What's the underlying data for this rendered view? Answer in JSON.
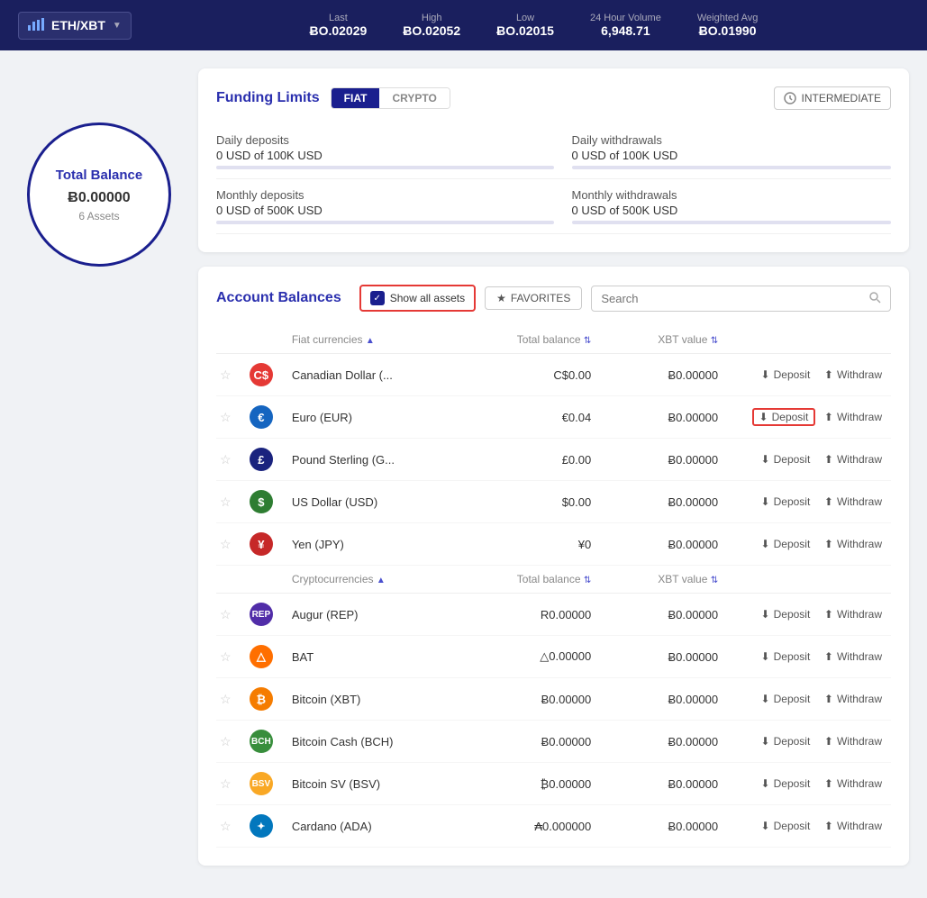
{
  "header": {
    "pair": "ETH/XBT",
    "chart_icon": "chart-icon",
    "stats": [
      {
        "label": "Last",
        "value": "ɃO.02029"
      },
      {
        "label": "High",
        "value": "ɃO.02052"
      },
      {
        "label": "Low",
        "value": "ɃO.02015"
      },
      {
        "label": "24 Hour Volume",
        "value": "6,948.71"
      },
      {
        "label": "Weighted Avg",
        "value": "ɃO.01990"
      }
    ]
  },
  "total_balance": {
    "title": "Total Balance",
    "amount": "Ƀ0.00000",
    "assets": "6 Assets"
  },
  "funding_limits": {
    "title": "Funding Limits",
    "fiat_label": "FIAT",
    "crypto_label": "CRYPTO",
    "intermediate_label": "INTERMEDIATE",
    "rows": [
      {
        "label": "Daily deposits",
        "value": "0 USD of 100K USD",
        "side": "left"
      },
      {
        "label": "Daily withdrawals",
        "value": "0 USD of 100K USD",
        "side": "right"
      },
      {
        "label": "Monthly deposits",
        "value": "0 USD of 500K USD",
        "side": "left"
      },
      {
        "label": "Monthly withdrawals",
        "value": "0 USD of 500K USD",
        "side": "right"
      }
    ]
  },
  "account_balances": {
    "title": "Account Balances",
    "show_all_label": "Show all assets",
    "favorites_label": "FAVORITES",
    "search_placeholder": "Search",
    "fiat_section": "Fiat currencies",
    "crypto_section": "Cryptocurrencies",
    "total_balance_col": "Total balance",
    "xbt_value_col": "XBT value",
    "deposit_label": "Deposit",
    "withdraw_label": "Withdraw",
    "fiat_currencies": [
      {
        "name": "Canadian Dollar (...",
        "icon_class": "icon-cad",
        "icon_text": "C$",
        "total": "C$0.00",
        "xbt": "Ƀ0.00000",
        "highlight_deposit": false
      },
      {
        "name": "Euro (EUR)",
        "icon_class": "icon-eur",
        "icon_text": "€",
        "total": "€0.04",
        "xbt": "Ƀ0.00000",
        "highlight_deposit": true
      },
      {
        "name": "Pound Sterling (G...",
        "icon_class": "icon-gbp",
        "icon_text": "£",
        "total": "£0.00",
        "xbt": "Ƀ0.00000",
        "highlight_deposit": false
      },
      {
        "name": "US Dollar (USD)",
        "icon_class": "icon-usd",
        "icon_text": "$",
        "total": "$0.00",
        "xbt": "Ƀ0.00000",
        "highlight_deposit": false
      },
      {
        "name": "Yen (JPY)",
        "icon_class": "icon-jpy",
        "icon_text": "¥",
        "total": "¥0",
        "xbt": "Ƀ0.00000",
        "highlight_deposit": false
      }
    ],
    "cryptocurrencies": [
      {
        "name": "Augur (REP)",
        "icon_class": "icon-rep",
        "icon_text": "R",
        "total": "R0.00000",
        "xbt": "Ƀ0.00000",
        "highlight_deposit": false
      },
      {
        "name": "BAT",
        "icon_class": "icon-bat",
        "icon_text": "△",
        "total": "△0.00000",
        "xbt": "Ƀ0.00000",
        "highlight_deposit": false
      },
      {
        "name": "Bitcoin (XBT)",
        "icon_class": "icon-btc",
        "icon_text": "₿",
        "total": "Ƀ0.00000",
        "xbt": "Ƀ0.00000",
        "highlight_deposit": false
      },
      {
        "name": "Bitcoin Cash (BCH)",
        "icon_class": "icon-bch",
        "icon_text": "Ƀ",
        "total": "Ƀ0.00000",
        "xbt": "Ƀ0.00000",
        "highlight_deposit": false
      },
      {
        "name": "Bitcoin SV (BSV)",
        "icon_class": "icon-bsv",
        "icon_text": "₿",
        "total": "₿0.00000",
        "xbt": "Ƀ0.00000",
        "highlight_deposit": false
      },
      {
        "name": "Cardano (ADA)",
        "icon_class": "icon-ada",
        "icon_text": "✦",
        "total": "₳0.000000",
        "xbt": "Ƀ0.00000",
        "highlight_deposit": false
      }
    ]
  }
}
